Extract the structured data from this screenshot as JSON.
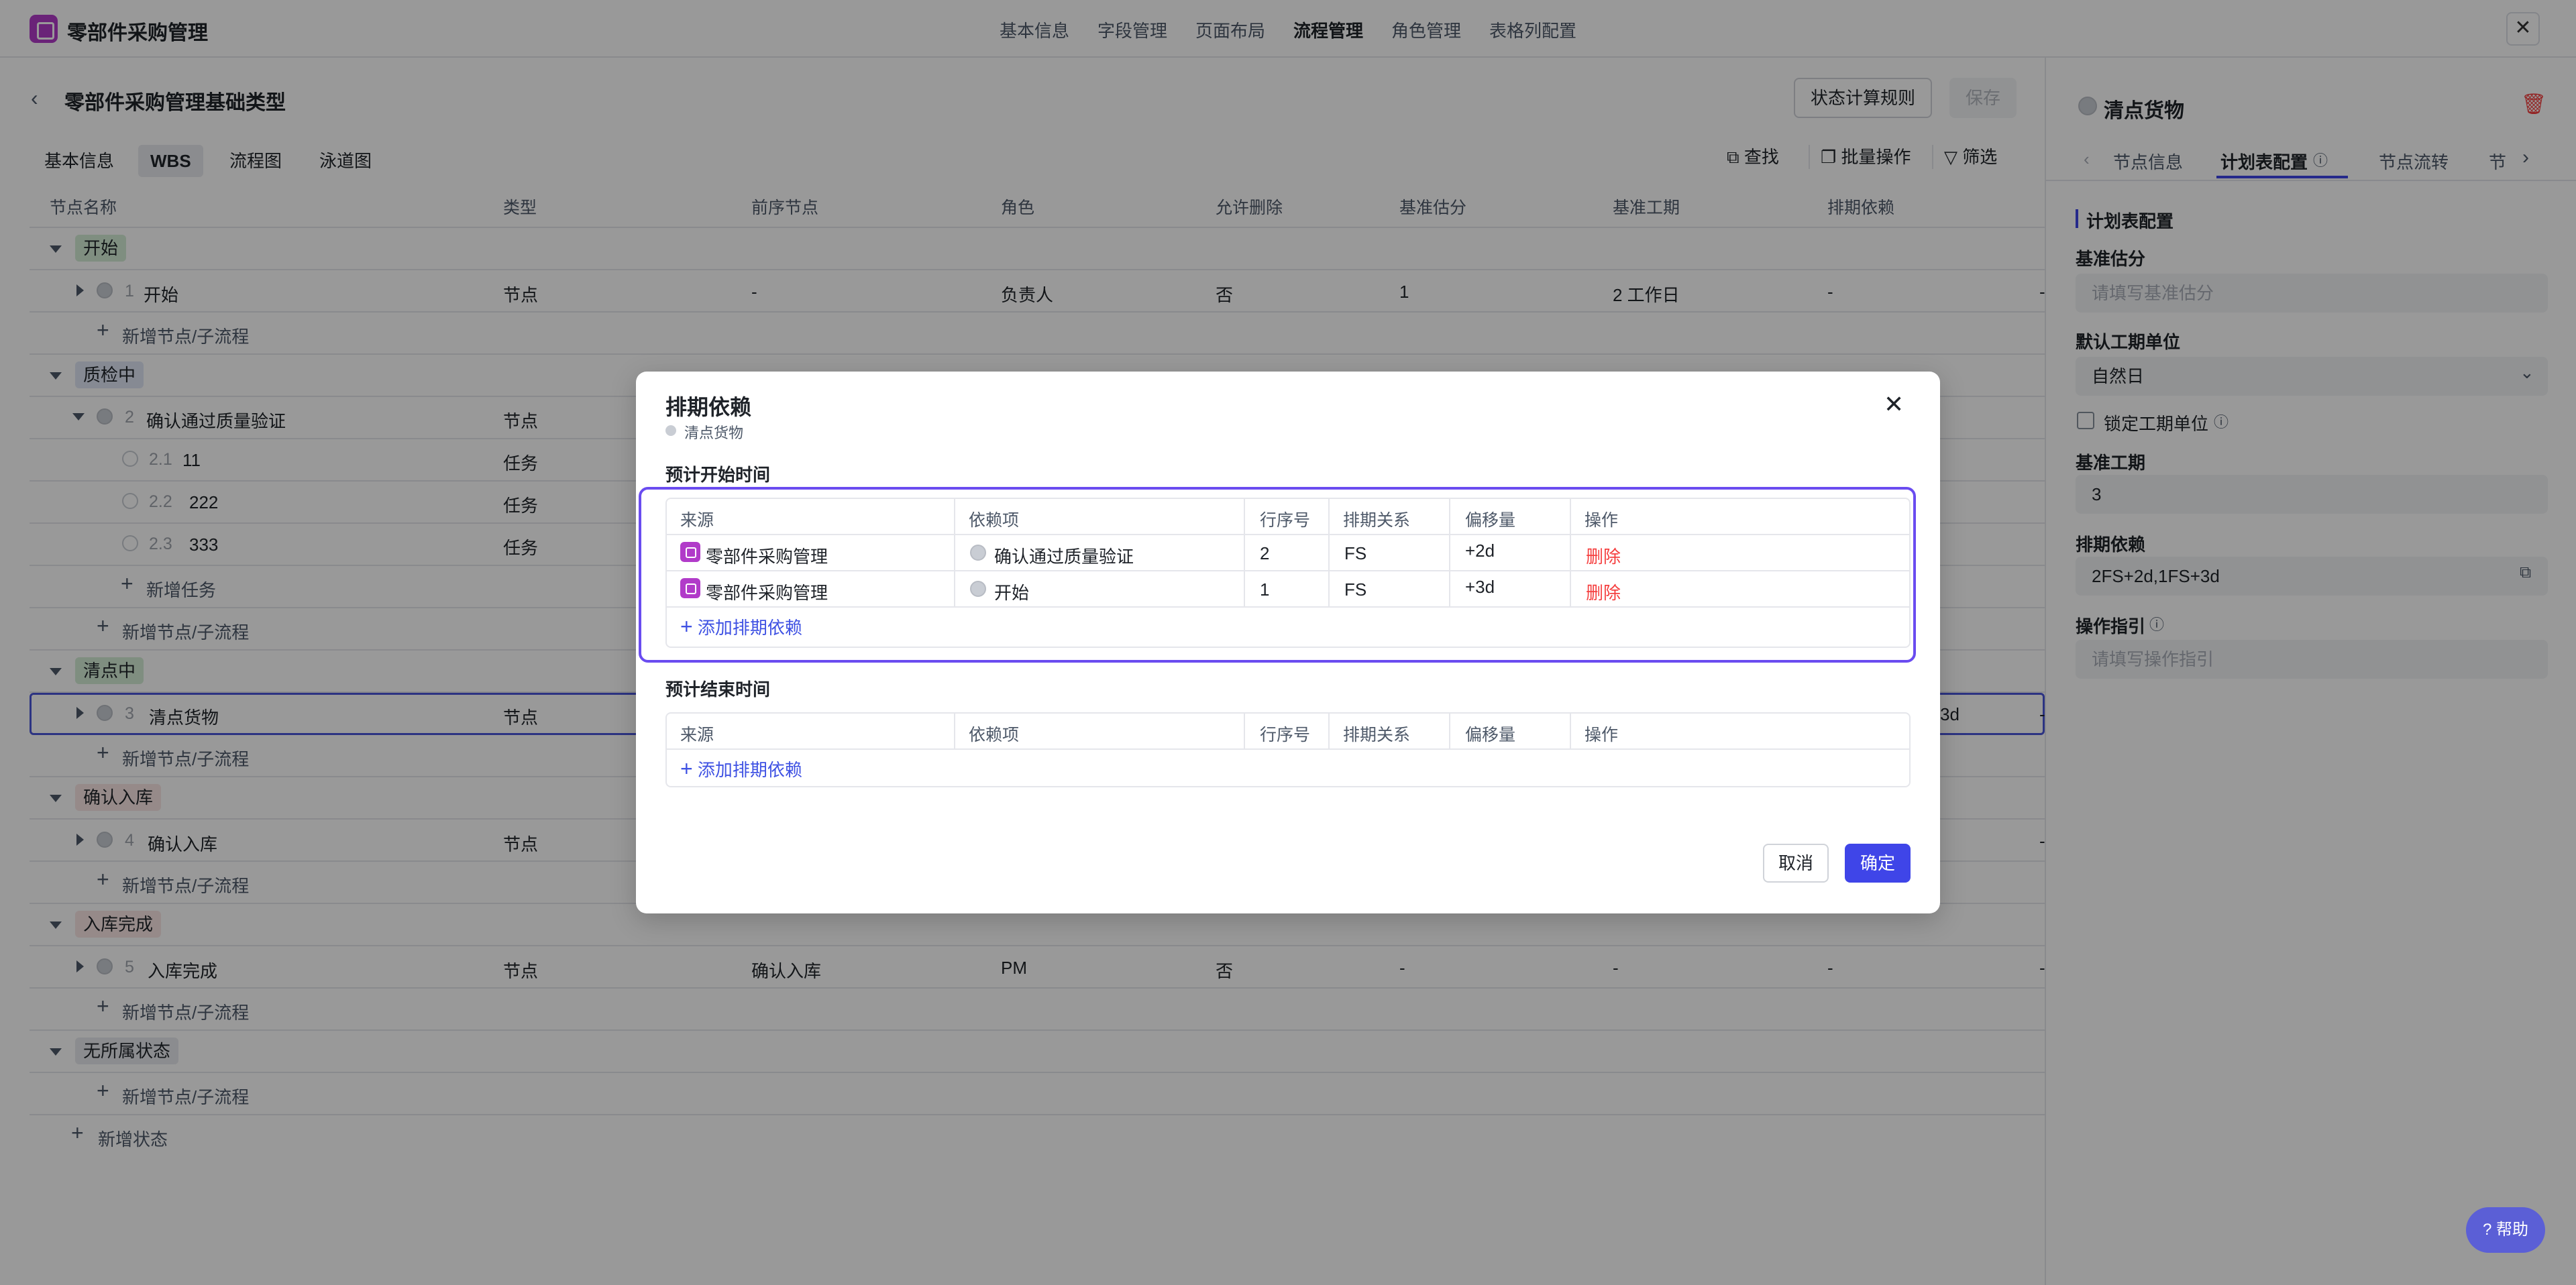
{
  "app": {
    "title": "零部件采购管理"
  },
  "top_tabs": [
    "基本信息",
    "字段管理",
    "页面布局",
    "流程管理",
    "角色管理",
    "表格列配置"
  ],
  "header": {
    "title": "零部件采购管理基础类型",
    "state_rule_btn": "状态计算规则",
    "save_btn": "保存"
  },
  "sub_tabs": [
    "基本信息",
    "WBS",
    "流程图",
    "泳道图"
  ],
  "tools": {
    "find": "查找",
    "batch": "批量操作",
    "filter": "筛选"
  },
  "columns": [
    "节点名称",
    "类型",
    "前序节点",
    "角色",
    "允许删除",
    "基准估分",
    "基准工期",
    "排期依赖"
  ],
  "groups": {
    "start": "开始",
    "qc": "质检中",
    "counting": "清点中",
    "confirm": "确认入库",
    "done": "入库完成",
    "none": "无所属状态"
  },
  "rows": {
    "r1": {
      "num": "1",
      "name": "开始",
      "type": "节点",
      "pre": "-",
      "role": "负责人",
      "del": "否",
      "est": "1",
      "dur": "2 工作日",
      "dep": "-",
      "last": "-"
    },
    "r2": {
      "num": "2",
      "name": "确认通过质量验证",
      "type": "节点"
    },
    "r21": {
      "num": "2.1",
      "name": "11",
      "type": "任务"
    },
    "r22": {
      "num": "2.2",
      "name": "222",
      "type": "任务"
    },
    "r23": {
      "num": "2.3",
      "name": "333",
      "type": "任务"
    },
    "r3": {
      "num": "3",
      "name": "清点货物",
      "type": "节点",
      "dep": "3d",
      "last": "-"
    },
    "r4": {
      "num": "4",
      "name": "确认入库",
      "type": "节点",
      "last": "-"
    },
    "r5": {
      "num": "5",
      "name": "入库完成",
      "type": "节点",
      "pre": "确认入库",
      "role": "PM",
      "del": "否",
      "est": "-",
      "dur": "-",
      "dep": "-",
      "last": "-"
    }
  },
  "add_node": "新增节点/子流程",
  "add_task": "新增任务",
  "add_state": "新增状态",
  "right_panel": {
    "title": "清点货物",
    "tabs": [
      "节点信息",
      "计划表配置",
      "节点流转",
      "节"
    ],
    "section": "计划表配置",
    "est_label": "基准估分",
    "est_placeholder": "请填写基准估分",
    "unit_label": "默认工期单位",
    "unit_value": "自然日",
    "lock_label": "锁定工期单位",
    "dur_label": "基准工期",
    "dur_value": "3",
    "dep_label": "排期依赖",
    "dep_value": "2FS+2d,1FS+3d",
    "guide_label": "操作指引",
    "guide_placeholder": "请填写操作指引"
  },
  "modal": {
    "title": "排期依赖",
    "subtitle": "清点货物",
    "start_label": "预计开始时间",
    "end_label": "预计结束时间",
    "table_headers": [
      "来源",
      "依赖项",
      "行序号",
      "排期关系",
      "偏移量",
      "操作"
    ],
    "start_rows": [
      {
        "source": "零部件采购管理",
        "dep": "确认通过质量验证",
        "seq": "2",
        "rel": "FS",
        "offset": "+2d",
        "op": "删除"
      },
      {
        "source": "零部件采购管理",
        "dep": "开始",
        "seq": "1",
        "rel": "FS",
        "offset": "+3d",
        "op": "删除"
      }
    ],
    "add_dep": "添加排期依赖",
    "cancel": "取消",
    "ok": "确定"
  },
  "help": "帮助",
  "colors": {
    "accent": "#3f45e8",
    "brand": "#b13bc9",
    "danger": "#f53f3f",
    "highlight": "#6a4cf0"
  }
}
